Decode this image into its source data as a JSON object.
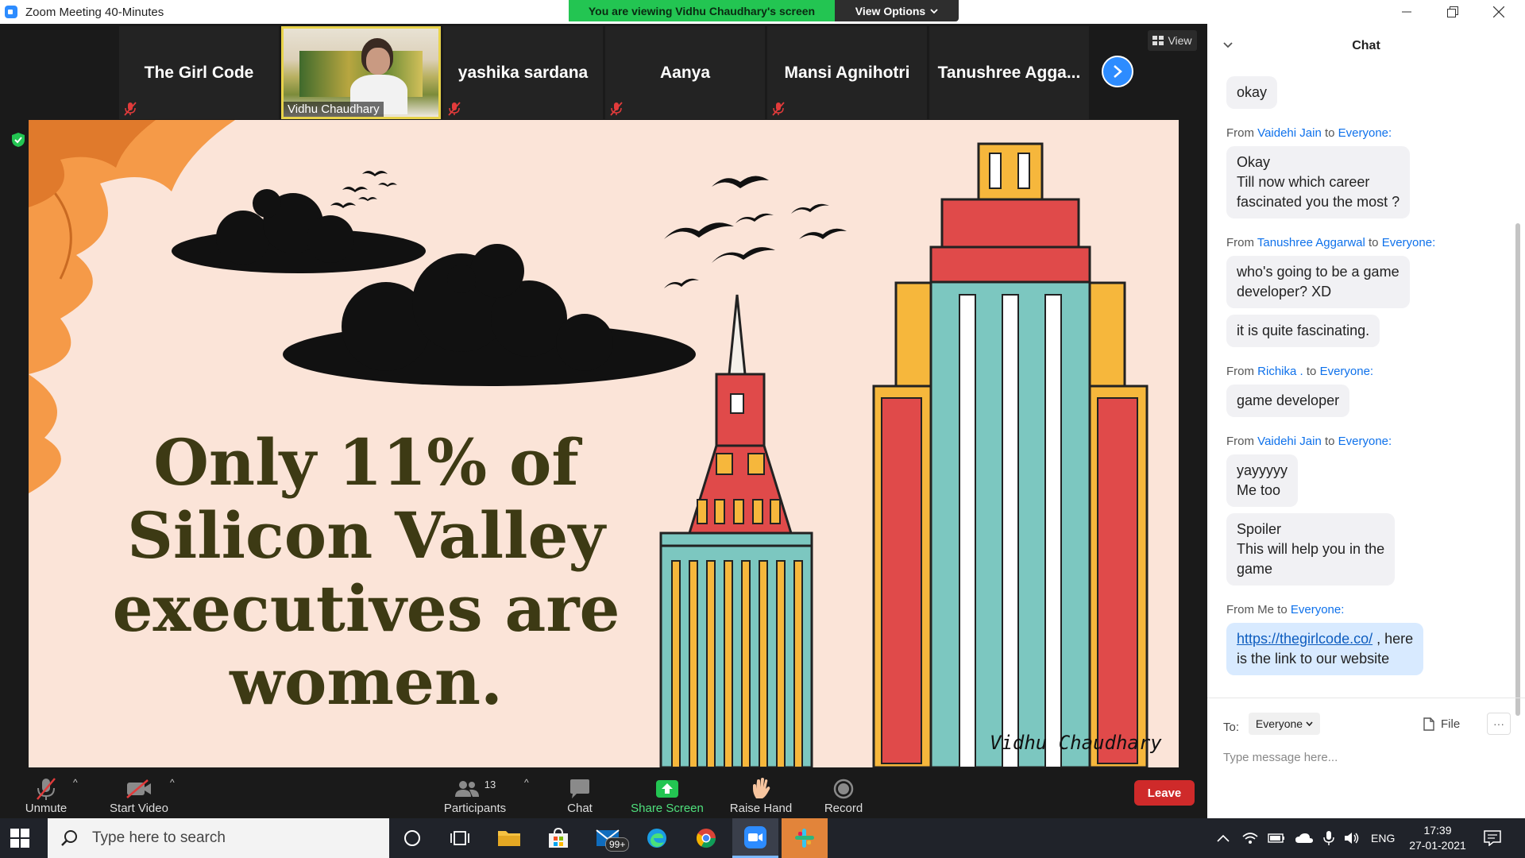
{
  "window": {
    "title": "Zoom Meeting 40-Minutes",
    "viewing_banner": "You are viewing Vidhu Chaudhary's screen",
    "view_options": "View Options"
  },
  "participants_strip": {
    "tiles": [
      {
        "name": "The Girl Code"
      },
      {
        "name": "Vidhu Chaudhary"
      },
      {
        "name": "yashika sardana"
      },
      {
        "name": "Aanya"
      },
      {
        "name": "Mansi Agnihotri"
      },
      {
        "name": "Tanushree  Agga..."
      }
    ],
    "view_label": "View"
  },
  "slide": {
    "headline_lines": [
      "Only 11% of",
      "Silicon Valley",
      "executives are",
      "women."
    ],
    "signature": "Vidhu Chaudhary"
  },
  "toolbar": {
    "unmute": "Unmute",
    "start_video": "Start Video",
    "participants": "Participants",
    "participants_count": "13",
    "chat": "Chat",
    "share_screen": "Share Screen",
    "raise_hand": "Raise Hand",
    "record": "Record",
    "leave": "Leave"
  },
  "chat": {
    "title": "Chat",
    "first_bubble": "okay",
    "messages": [
      {
        "from": "Vaidehi Jain",
        "to": "Everyone:",
        "bubbles": [
          [
            "Okay",
            "Till now which career",
            "fascinated you the most ?"
          ]
        ]
      },
      {
        "from": "Tanushree Aggarwal",
        "to": "Everyone:",
        "bubbles": [
          [
            "who's going to be a game",
            "developer? XD"
          ],
          [
            "it is quite fascinating."
          ]
        ]
      },
      {
        "from": "Richika .",
        "to": "Everyone:",
        "bubbles": [
          [
            "game developer"
          ]
        ]
      },
      {
        "from": "Vaidehi Jain",
        "to": "Everyone:",
        "bubbles": [
          [
            "yayyyyy",
            "Me too"
          ],
          [
            "Spoiler",
            "This will help you in the",
            "game"
          ]
        ]
      }
    ],
    "my_message": {
      "from": "Me",
      "to": "Everyone:",
      "link": "https://thegirlcode.co/",
      "line1_rest": " , here",
      "line2": "is the link to our website"
    },
    "to_label": "To:",
    "to_value": "Everyone",
    "file_label": "File",
    "more_label": "···",
    "input_placeholder": "Type message here..."
  },
  "taskbar": {
    "search_placeholder": "Type here to search",
    "mail_badge": "99+",
    "language": "ENG",
    "time": "17:39",
    "date": "27-01-2021"
  },
  "colors": {
    "zoom_blue": "#2d8cff",
    "share_green": "#23c552",
    "leave_red": "#cf2a2a",
    "slide_bg": "#fbe4d8",
    "headline": "#3d3a14"
  }
}
